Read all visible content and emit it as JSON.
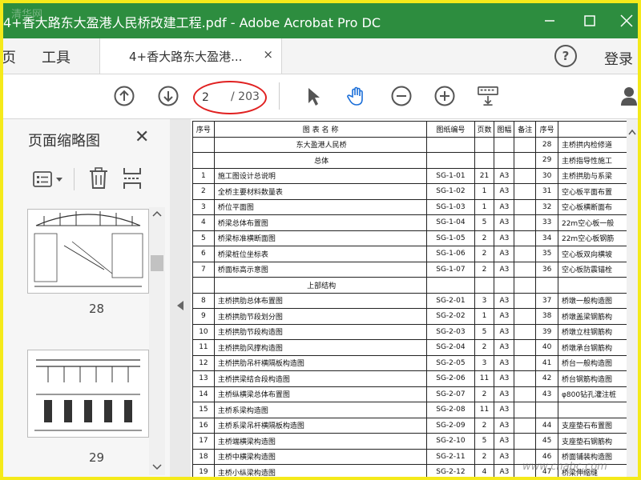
{
  "window": {
    "title": "4+香大路东大盈港人民桥改建工程.pdf - Adobe Acrobat Pro DC",
    "watermark": "清华网",
    "controls": [
      "minimize",
      "maximize",
      "close"
    ]
  },
  "menubar": {
    "items": [
      "页",
      "工具"
    ],
    "tab_label": "4+香大路东大盈港...",
    "tab_close": "×",
    "help": "?",
    "login": "登录"
  },
  "toolbar": {
    "current_page": "2",
    "total_pages": "/ 203",
    "icons": [
      "page-up-icon",
      "page-down-icon",
      "select-arrow-icon",
      "hand-icon",
      "zoom-out-icon",
      "zoom-in-icon",
      "keyboard-icon",
      "share-user-icon"
    ]
  },
  "sidebar": {
    "heading": "页面缩略图",
    "close": "✕",
    "thumbnails": [
      {
        "label": "28"
      },
      {
        "label": "29"
      }
    ]
  },
  "document": {
    "headers": [
      "序号",
      "图 表 名 称",
      "图纸编号",
      "页数",
      "图幅",
      "备注",
      "序号"
    ],
    "left_rows": [
      {
        "no": "",
        "name": "东大盈港人民桥",
        "code": "",
        "pages": "",
        "size": "",
        "section": true
      },
      {
        "no": "",
        "name": "总体",
        "code": "",
        "pages": "",
        "size": "",
        "section": true
      },
      {
        "no": "1",
        "name": "施工图设计总说明",
        "code": "SG-1-01",
        "pages": "21",
        "size": "A3"
      },
      {
        "no": "2",
        "name": "全桥主要材料数量表",
        "code": "SG-1-02",
        "pages": "1",
        "size": "A3"
      },
      {
        "no": "3",
        "name": "桥位平面图",
        "code": "SG-1-03",
        "pages": "1",
        "size": "A3"
      },
      {
        "no": "4",
        "name": "桥梁总体布置图",
        "code": "SG-1-04",
        "pages": "5",
        "size": "A3"
      },
      {
        "no": "5",
        "name": "桥梁标准横断面图",
        "code": "SG-1-05",
        "pages": "2",
        "size": "A3"
      },
      {
        "no": "6",
        "name": "桥梁桩位坐标表",
        "code": "SG-1-06",
        "pages": "2",
        "size": "A3"
      },
      {
        "no": "7",
        "name": "桥面标高示意图",
        "code": "SG-1-07",
        "pages": "2",
        "size": "A3"
      },
      {
        "no": "",
        "name": "上部结构",
        "code": "",
        "pages": "",
        "size": "",
        "section": true
      },
      {
        "no": "8",
        "name": "主桥拱肋总体布置图",
        "code": "SG-2-01",
        "pages": "3",
        "size": "A3"
      },
      {
        "no": "9",
        "name": "主桥拱肋节段划分图",
        "code": "SG-2-02",
        "pages": "1",
        "size": "A3"
      },
      {
        "no": "10",
        "name": "主桥拱肋节段构造图",
        "code": "SG-2-03",
        "pages": "5",
        "size": "A3"
      },
      {
        "no": "11",
        "name": "主桥拱肋风撑构造图",
        "code": "SG-2-04",
        "pages": "2",
        "size": "A3"
      },
      {
        "no": "12",
        "name": "主桥拱肋吊杆横隔板构造图",
        "code": "SG-2-05",
        "pages": "3",
        "size": "A3"
      },
      {
        "no": "13",
        "name": "主桥拱梁结合段构造图",
        "code": "SG-2-06",
        "pages": "11",
        "size": "A3"
      },
      {
        "no": "14",
        "name": "主桥纵横梁总体布置图",
        "code": "SG-2-07",
        "pages": "2",
        "size": "A3"
      },
      {
        "no": "15",
        "name": "主桥系梁构造图",
        "code": "SG-2-08",
        "pages": "11",
        "size": "A3"
      },
      {
        "no": "16",
        "name": "主桥系梁吊杆横隔板构造图",
        "code": "SG-2-09",
        "pages": "2",
        "size": "A3"
      },
      {
        "no": "17",
        "name": "主桥端横梁构造图",
        "code": "SG-2-10",
        "pages": "5",
        "size": "A3"
      },
      {
        "no": "18",
        "name": "主桥中横梁构造图",
        "code": "SG-2-11",
        "pages": "2",
        "size": "A3"
      },
      {
        "no": "19",
        "name": "主桥小纵梁构造图",
        "code": "SG-2-12",
        "pages": "4",
        "size": "A3"
      }
    ],
    "right_rows": [
      {
        "no": "28",
        "name": "主桥拱内检修道"
      },
      {
        "no": "29",
        "name": "主桥指导性施工"
      },
      {
        "no": "30",
        "name": "主桥拱肋与系梁"
      },
      {
        "no": "31",
        "name": "空心板平面布置"
      },
      {
        "no": "32",
        "name": "空心板横断面布"
      },
      {
        "no": "33",
        "name": "22m空心板一般"
      },
      {
        "no": "34",
        "name": "22m空心板钢筋"
      },
      {
        "no": "35",
        "name": "空心板双向横坡"
      },
      {
        "no": "36",
        "name": "空心板防震锚栓"
      },
      {
        "no": "",
        "name": ""
      },
      {
        "no": "37",
        "name": "桥墩一般构造图"
      },
      {
        "no": "38",
        "name": "桥墩盖梁钢筋构"
      },
      {
        "no": "39",
        "name": "桥墩立柱钢筋构"
      },
      {
        "no": "40",
        "name": "桥墩承台钢筋构"
      },
      {
        "no": "41",
        "name": "桥台一般构造图"
      },
      {
        "no": "42",
        "name": "桥台钢筋构造图"
      },
      {
        "no": "43",
        "name": "φ800钻孔灌注桩"
      },
      {
        "no": "",
        "name": ""
      },
      {
        "no": "44",
        "name": "支座垫石布置图"
      },
      {
        "no": "45",
        "name": "支座垫石钢筋构"
      },
      {
        "no": "46",
        "name": "桥面铺装构造图"
      },
      {
        "no": "47",
        "name": "桥梁伸缩缝"
      }
    ],
    "corner_watermark": "www.cnabc.com"
  }
}
